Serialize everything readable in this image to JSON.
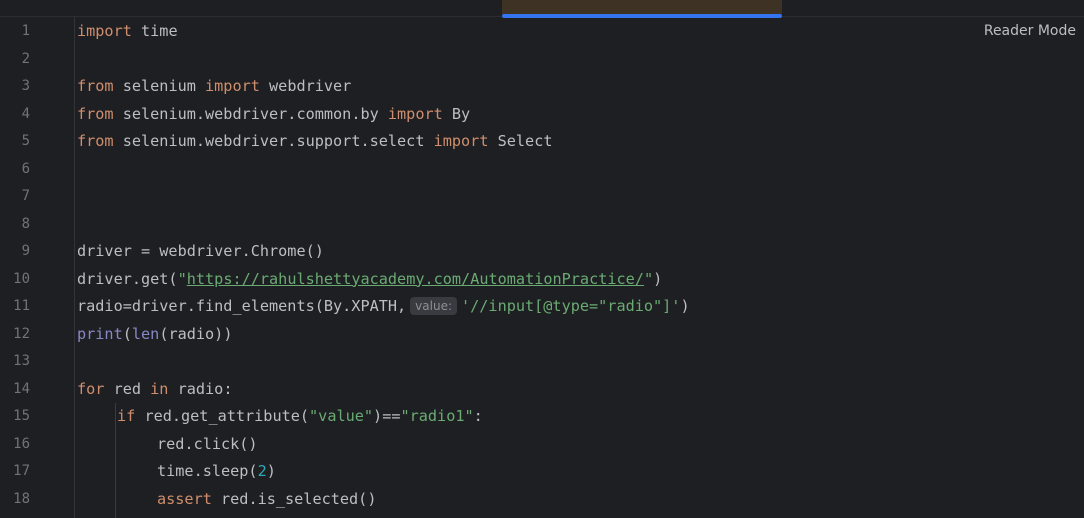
{
  "editor": {
    "reader_mode_label": "Reader Mode",
    "param_hint": "value:",
    "line_numbers": [
      "1",
      "2",
      "3",
      "4",
      "5",
      "6",
      "7",
      "8",
      "9",
      "10",
      "11",
      "12",
      "13",
      "14",
      "15",
      "16",
      "17",
      "18"
    ],
    "code": {
      "l1_kw": "import",
      "l1_rest": " time",
      "l3_kw1": "from",
      "l3_mid": " selenium ",
      "l3_kw2": "import",
      "l3_rest": " webdriver",
      "l4_kw1": "from",
      "l4_mid": " selenium.webdriver.common.by ",
      "l4_kw2": "import",
      "l4_rest": " By",
      "l5_kw1": "from",
      "l5_mid": " selenium.webdriver.support.select ",
      "l5_kw2": "import",
      "l5_rest": " Select",
      "l9": "driver = webdriver.Chrome()",
      "l10_pre": "driver.get(",
      "l10_q1": "\"",
      "l10_url": "https://rahulshettyacademy.com/AutomationPractice/",
      "l10_q2": "\"",
      "l10_post": ")",
      "l11_pre": "radio=driver.find_elements(By.XPATH,",
      "l11_str": "'//input[@type=\"radio\"]'",
      "l11_post": ")",
      "l12_print": "print",
      "l12_a": "(",
      "l12_len": "len",
      "l12_b": "(radio))",
      "l14_kw1": "for",
      "l14_mid": " red ",
      "l14_kw2": "in",
      "l14_rest": " radio:",
      "l15_kw": "if",
      "l15_mid": " red.get_attribute(",
      "l15_s1": "\"value\"",
      "l15_op": ")==",
      "l15_s2": "\"radio1\"",
      "l15_end": ":",
      "l16": "red.click()",
      "l17_pre": "time.sleep(",
      "l17_num": "2",
      "l17_post": ")",
      "l18_kw": "assert",
      "l18_rest": " red.is_selected()"
    }
  },
  "colors": {
    "background": "#1e1f22",
    "keyword": "#cf8e6d",
    "string": "#6aab73",
    "number": "#2aacb8",
    "active_tab_underline": "#3574f0"
  }
}
